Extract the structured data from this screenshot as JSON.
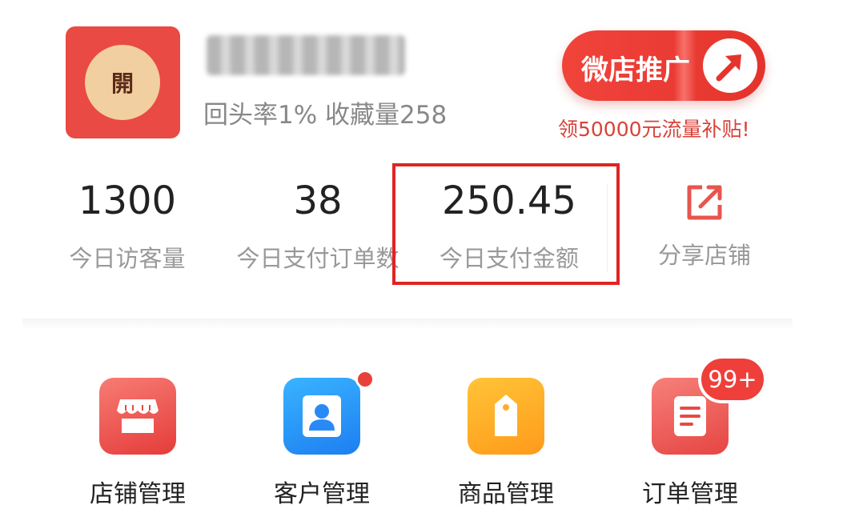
{
  "store": {
    "avatar_char": "開",
    "stats": "回头率1% 收藏量258"
  },
  "promo": {
    "label": "微店推广",
    "subtitle": "领50000元流量补贴!"
  },
  "metrics": [
    {
      "value": "1300",
      "label": "今日访客量"
    },
    {
      "value": "38",
      "label": "今日支付订单数"
    },
    {
      "value": "250.45",
      "label": "今日支付金额"
    }
  ],
  "share": {
    "label": "分享店铺"
  },
  "apps": [
    {
      "icon": "store-icon",
      "label": "店铺管理"
    },
    {
      "icon": "customer-icon",
      "label": "客户管理"
    },
    {
      "icon": "product-tag-icon",
      "label": "商品管理"
    },
    {
      "icon": "order-icon",
      "label": "订单管理"
    }
  ],
  "order_badge": "99+",
  "colors": {
    "accent": "#e94a43",
    "highlight_border": "#e02424"
  }
}
